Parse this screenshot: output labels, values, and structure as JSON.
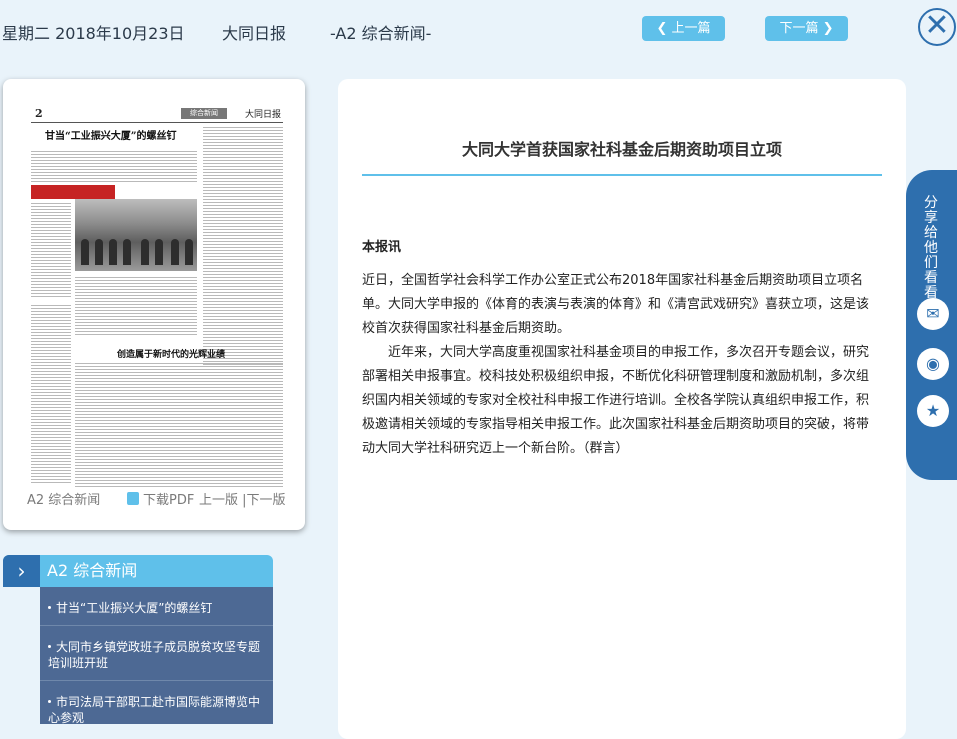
{
  "header": {
    "date": "星期二 2018年10月23日",
    "paper_name": "大同日报",
    "section": "-A2 综合新闻-",
    "prev_label": "上一篇",
    "next_label": "下一篇"
  },
  "preview": {
    "page_number": "2",
    "page_tab": "综合新闻",
    "logo": "大同日报",
    "headline_1": "甘当“工业振兴大厦”的螺丝钉",
    "headline_2": "创造属于新时代的光辉业绩",
    "section_label": "A2 综合新闻",
    "download_label": "下载PDF",
    "page_nav": "上一版 |下一版"
  },
  "section_list": {
    "title": "A2  综合新闻",
    "items": [
      "甘当“工业振兴大厦”的螺丝钉",
      "大同市乡镇党政班子成员脱贫攻坚专题培训班开班",
      "市司法局干部职工赴市国际能源博览中心参观"
    ]
  },
  "article": {
    "title": "大同大学首获国家社科基金后期资助项目立项",
    "byline": "本报讯",
    "paragraph_1": "近日，全国哲学社会科学工作办公室正式公布2018年国家社科基金后期资助项目立项名单。大同大学申报的《体育的表演与表演的体育》和《清宫武戏研究》喜获立项，这是该校首次获得国家社科基金后期资助。",
    "paragraph_2": "近年来，大同大学高度重视国家社科基金项目的申报工作，多次召开专题会议，研究部署相关申报事宜。校科技处积极组织申报，不断优化科研管理制度和激励机制，多次组织国内相关领域的专家对全校社科申报工作进行培训。全校各学院认真组织申报工作，积极邀请相关领域的专家指导相关申报工作。此次国家社科基金后期资助项目的突破，将带动大同大学社科研究迈上一个新台阶。（群言）"
  },
  "share": {
    "label": "分享给他们看看",
    "icons": [
      "wechat-icon",
      "weibo-icon",
      "qzone-icon"
    ]
  },
  "colors": {
    "accent_light": "#5fc0ea",
    "accent_dark": "#2e6fae",
    "list_bg": "#4d6994",
    "page_bg": "#e9f3fa"
  }
}
